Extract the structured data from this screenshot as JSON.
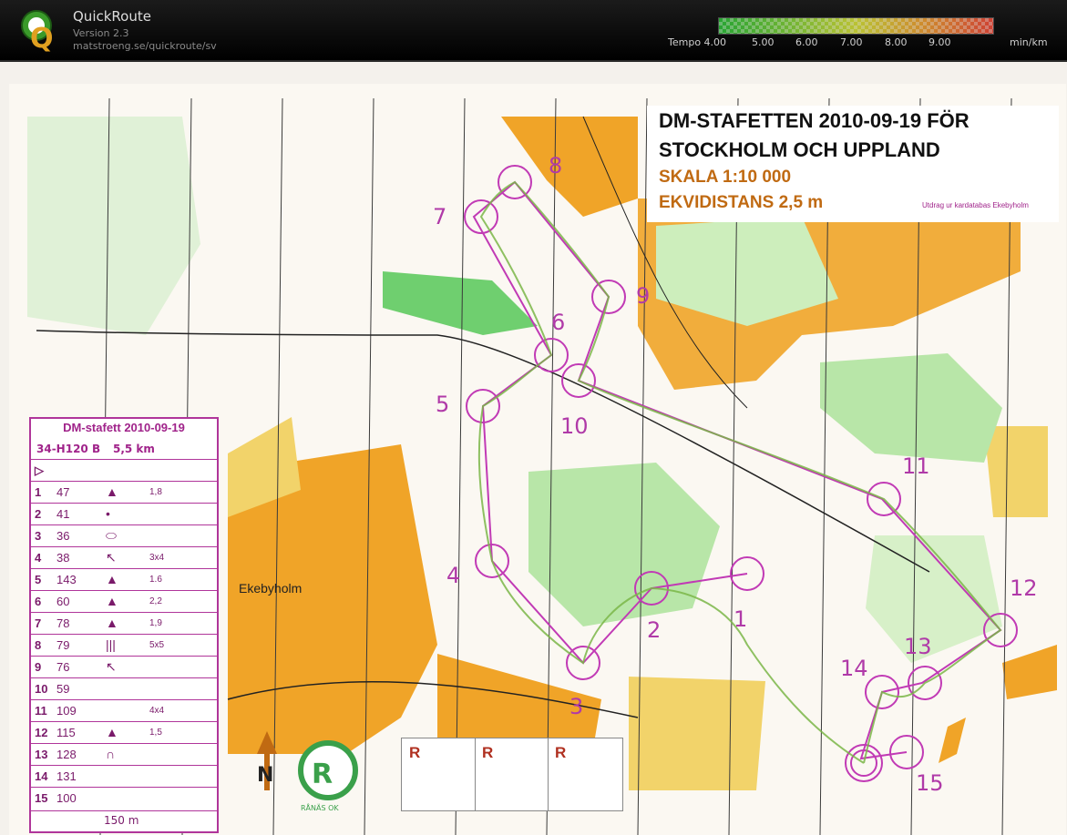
{
  "app": {
    "name": "QuickRoute",
    "version": "Version 2.3",
    "url": "matstroeng.se/quickroute/sv"
  },
  "tempo_scale": {
    "label": "Tempo 4.00",
    "ticks": [
      "5.00",
      "6.00",
      "7.00",
      "8.00",
      "9.00"
    ],
    "unit": "min/km",
    "colors": [
      "#2dbf3a",
      "#7fd13a",
      "#d8e23a",
      "#f0a034",
      "#f04a3a"
    ]
  },
  "map": {
    "title_line1": "DM-STAFETTEN 2010-09-19 FÖR",
    "title_line2": "STOCKHOLM OCH UPPLAND",
    "scale": "SKALA 1:10 000",
    "contour": "EKVIDISTANS 2,5 m",
    "source": "Utdrag ur kardatabas Ekebyholm",
    "place_name": "Ekebyholm",
    "club": "RÅNÄS OK",
    "relay_letters": [
      "R",
      "R",
      "R"
    ],
    "controls": [
      "1",
      "2",
      "3",
      "4",
      "5",
      "6",
      "7",
      "8",
      "9",
      "10",
      "11",
      "12",
      "13",
      "14",
      "15"
    ]
  },
  "control_description": {
    "title": "DM-stafett 2010-09-19",
    "course": "34-H120 B",
    "length": "5,5 km",
    "rows": [
      {
        "num": "1",
        "code": "47",
        "size": "1,8"
      },
      {
        "num": "2",
        "code": "41",
        "size": ""
      },
      {
        "num": "3",
        "code": "36",
        "size": ""
      },
      {
        "num": "4",
        "code": "38",
        "size": "3x4"
      },
      {
        "num": "5",
        "code": "143",
        "size": "1.6"
      },
      {
        "num": "6",
        "code": "60",
        "size": "2,2"
      },
      {
        "num": "7",
        "code": "78",
        "size": "1,9"
      },
      {
        "num": "8",
        "code": "79",
        "size": "5x5"
      },
      {
        "num": "9",
        "code": "76",
        "size": ""
      },
      {
        "num": "10",
        "code": "59",
        "size": ""
      },
      {
        "num": "11",
        "code": "109",
        "size": "4x4"
      },
      {
        "num": "12",
        "code": "115",
        "size": "1,5"
      },
      {
        "num": "13",
        "code": "128",
        "size": ""
      },
      {
        "num": "14",
        "code": "131",
        "size": ""
      },
      {
        "num": "15",
        "code": "100",
        "size": ""
      }
    ],
    "finish": "150 m"
  }
}
